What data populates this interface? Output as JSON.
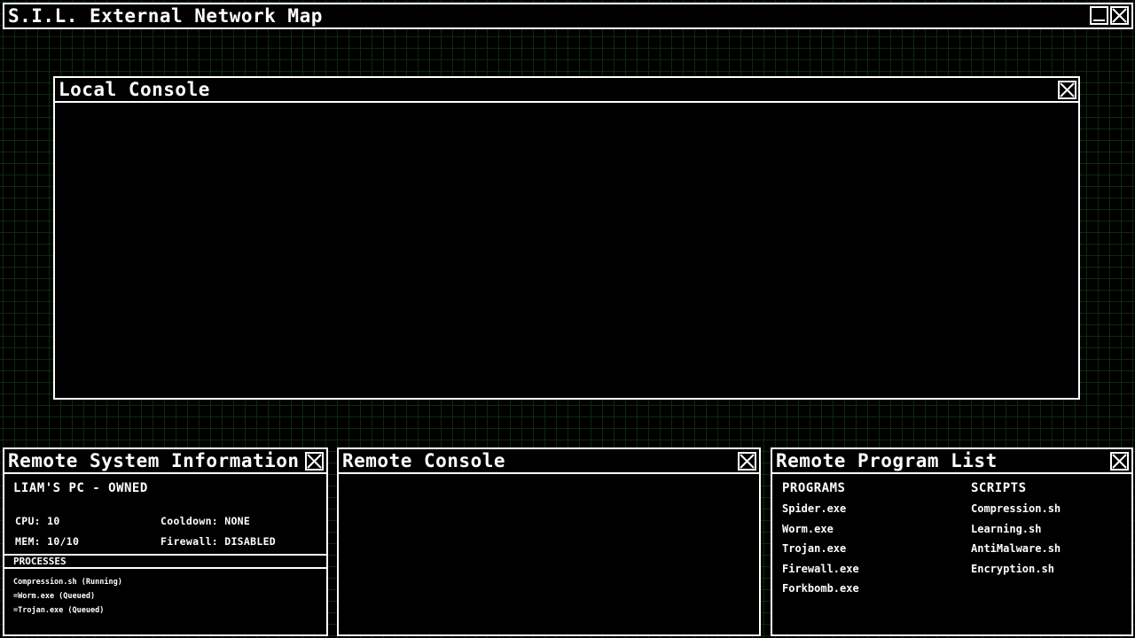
{
  "main_window": {
    "title": "S.I.L. External Network Map",
    "minimize_icon": "minimize-icon",
    "close_icon": "close-icon"
  },
  "local_console": {
    "title": "Local Console",
    "close_icon": "close-icon"
  },
  "remote_system_info": {
    "title": "Remote System Information",
    "close_icon": "close-icon",
    "system_name": "LIAM'S PC - OWNED",
    "cpu": "CPU: 10",
    "mem": "MEM: 10/10",
    "cooldown": "Cooldown: NONE",
    "firewall": "Firewall: DISABLED",
    "processes_header": "PROCESSES",
    "processes": [
      "Compression.sh (Running)",
      "=Worm.exe (Queued)",
      "=Trojan.exe (Queued)"
    ]
  },
  "remote_console": {
    "title": "Remote Console",
    "close_icon": "close-icon"
  },
  "remote_program_list": {
    "title": "Remote Program List",
    "close_icon": "close-icon",
    "programs_header": "PROGRAMS",
    "programs": [
      "Spider.exe",
      "Worm.exe",
      "Trojan.exe",
      "Firewall.exe",
      "Forkbomb.exe"
    ],
    "scripts_header": "SCRIPTS",
    "scripts": [
      "Compression.sh",
      "Learning.sh",
      "AntiMalware.sh",
      "Encryption.sh"
    ]
  },
  "colors": {
    "background": "#000000",
    "grid": "#0d2a0d",
    "foreground": "#ffffff"
  }
}
